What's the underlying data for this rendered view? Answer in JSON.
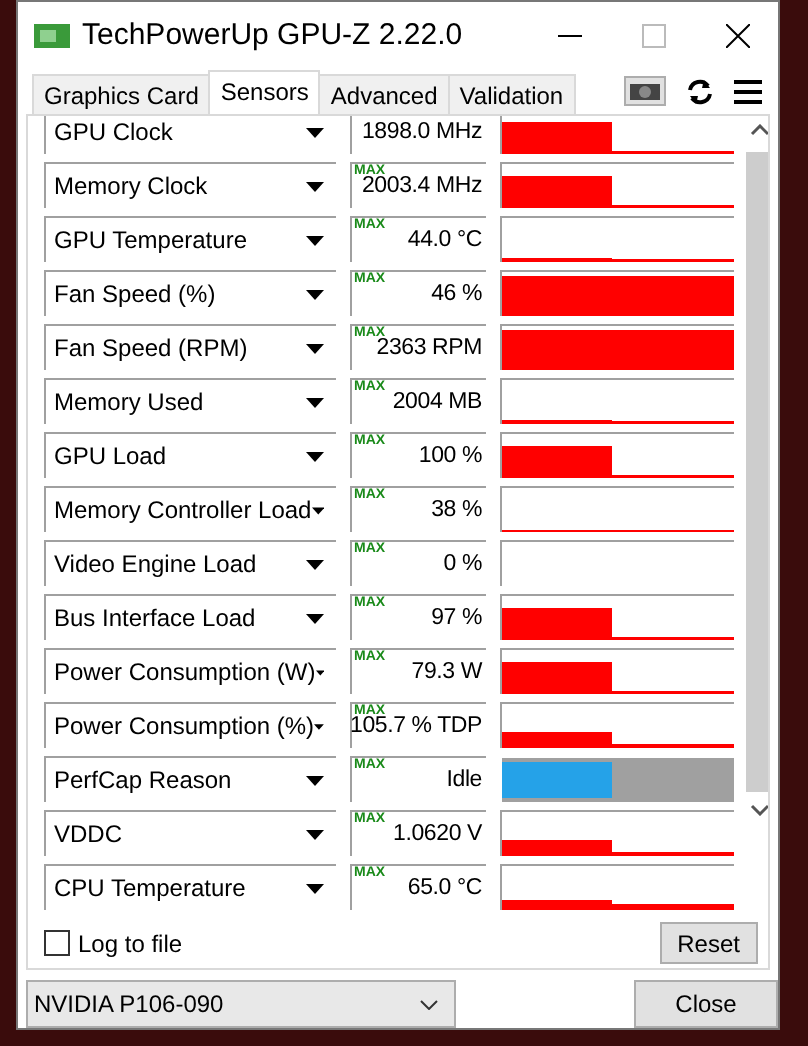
{
  "window": {
    "title": "TechPowerUp GPU-Z 2.22.0"
  },
  "tabs": [
    {
      "label": "Graphics Card",
      "selected": false
    },
    {
      "label": "Sensors",
      "selected": true
    },
    {
      "label": "Advanced",
      "selected": false
    },
    {
      "label": "Validation",
      "selected": false
    }
  ],
  "sensors": [
    {
      "name": "GPU Clock",
      "value": "1898.0 MHz",
      "kind": "high"
    },
    {
      "name": "Memory Clock",
      "max_label": "MAX",
      "value": "2003.4 MHz",
      "kind": "high"
    },
    {
      "name": "GPU Temperature",
      "max_label": "MAX",
      "value": "44.0 °C",
      "kind": "low"
    },
    {
      "name": "Fan Speed (%)",
      "max_label": "MAX",
      "value": "46 %",
      "kind": "full"
    },
    {
      "name": "Fan Speed (RPM)",
      "max_label": "MAX",
      "value": "2363 RPM",
      "kind": "full"
    },
    {
      "name": "Memory Used",
      "max_label": "MAX",
      "value": "2004 MB",
      "kind": "low"
    },
    {
      "name": "GPU Load",
      "max_label": "MAX",
      "value": "100 %",
      "kind": "high"
    },
    {
      "name": "Memory Controller Load",
      "max_label": "MAX",
      "value": "38 %",
      "kind": "flat"
    },
    {
      "name": "Video Engine Load",
      "max_label": "MAX",
      "value": "0 %",
      "kind": "empty"
    },
    {
      "name": "Bus Interface Load",
      "max_label": "MAX",
      "value": "97 %",
      "kind": "high"
    },
    {
      "name": "Power Consumption (W)",
      "max_label": "MAX",
      "value": "79.3 W",
      "kind": "high"
    },
    {
      "name": "Power Consumption (%)",
      "max_label": "MAX",
      "value": "105.7 % TDP",
      "kind": "mid"
    },
    {
      "name": "PerfCap Reason",
      "max_label": "MAX",
      "value": "Idle",
      "kind": "perfcap",
      "level": 0.47
    },
    {
      "name": "VDDC",
      "max_label": "MAX",
      "value": "1.0620 V",
      "kind": "mid"
    },
    {
      "name": "CPU Temperature",
      "max_label": "MAX",
      "value": "65.0 °C",
      "kind": "noisy"
    }
  ],
  "log_to_file": {
    "label": "Log to file",
    "checked": false
  },
  "reset_button": "Reset",
  "gpu_select": {
    "value": "NVIDIA P106-090"
  },
  "close_button": "Close"
}
